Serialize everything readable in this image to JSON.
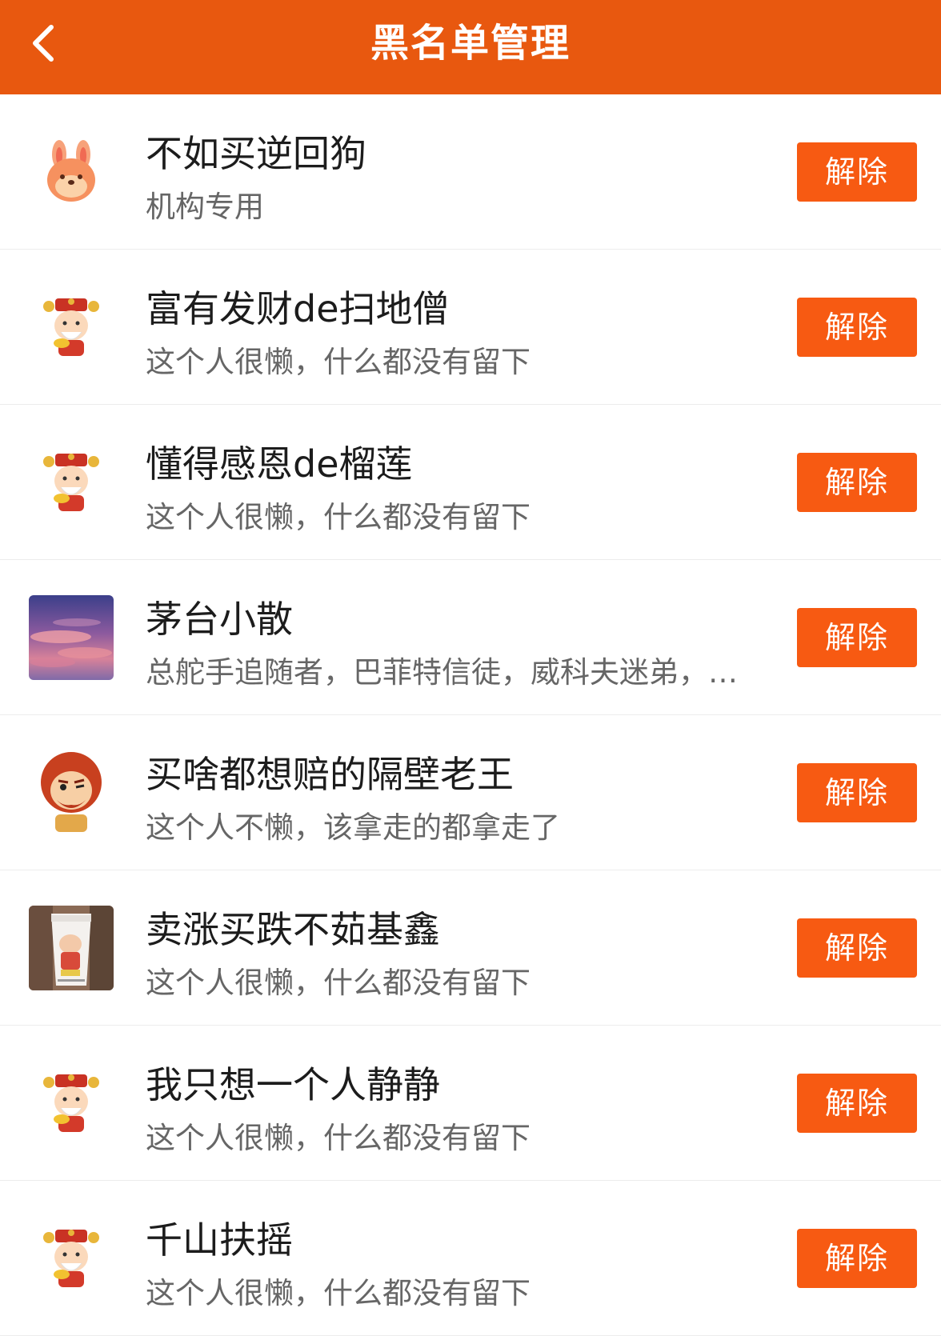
{
  "header": {
    "title": "黑名单管理",
    "back_icon": "chevron-left-icon",
    "background_color": "#e8580f"
  },
  "colors": {
    "accent": "#f75a12",
    "name_text": "#1c1c1c",
    "signature_text": "#666666"
  },
  "users": [
    {
      "name": "不如买逆回狗",
      "signature": "机构专用",
      "avatar": "rabbit-avatar",
      "button_label": "解除"
    },
    {
      "name": "富有发财de扫地僧",
      "signature": "这个人很懒，什么都没有留下",
      "avatar": "fortune-god-avatar",
      "button_label": "解除"
    },
    {
      "name": "懂得感恩de榴莲",
      "signature": "这个人很懒，什么都没有留下",
      "avatar": "fortune-god-avatar",
      "button_label": "解除"
    },
    {
      "name": "茅台小散",
      "signature": "总舵手追随者，巴菲特信徒，威科夫迷弟，…",
      "avatar": "sunset-sky-avatar",
      "button_label": "解除"
    },
    {
      "name": "买啥都想赔的隔壁老王",
      "signature": "这个人不懒，该拿走的都拿走了",
      "avatar": "red-hair-cartoon-avatar",
      "button_label": "解除"
    },
    {
      "name": "卖涨买跌不茹基鑫",
      "signature": "这个人很懒，什么都没有留下",
      "avatar": "coffee-cup-photo-avatar",
      "button_label": "解除"
    },
    {
      "name": "我只想一个人静静",
      "signature": "这个人很懒，什么都没有留下",
      "avatar": "fortune-god-avatar",
      "button_label": "解除"
    },
    {
      "name": "千山扶摇",
      "signature": "这个人很懒，什么都没有留下",
      "avatar": "fortune-god-avatar",
      "button_label": "解除"
    }
  ]
}
